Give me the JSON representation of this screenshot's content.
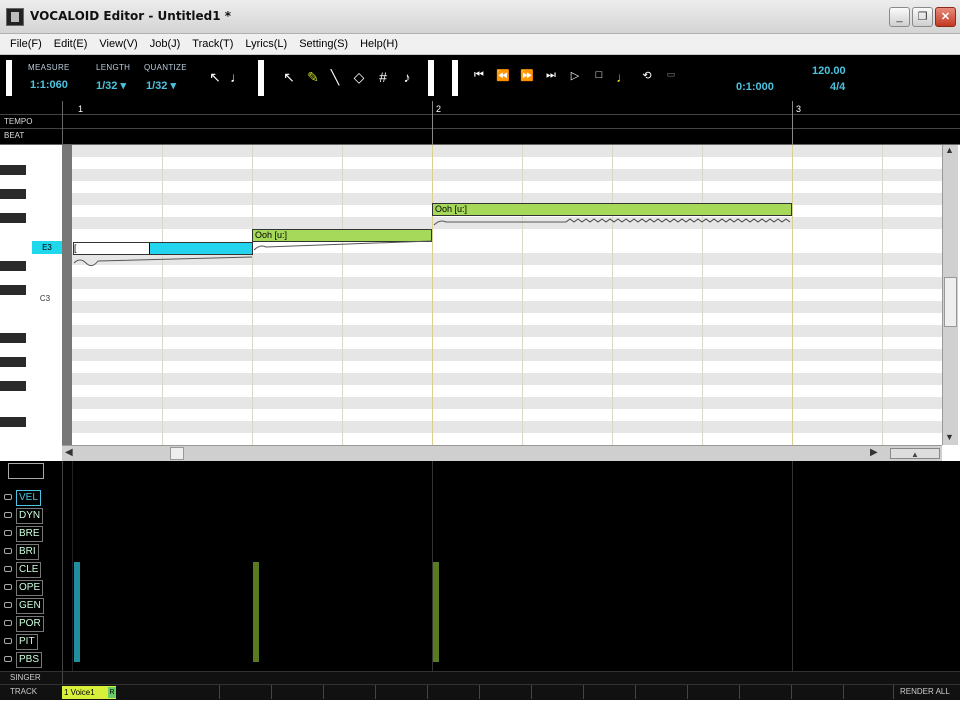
{
  "window": {
    "title": "VOCALOID Editor - Untitled1 *",
    "minimize_icon": "minimize-icon",
    "maximize_icon": "restore-icon",
    "close_icon": "close-icon"
  },
  "menu": [
    "File(F)",
    "Edit(E)",
    "View(V)",
    "Job(J)",
    "Track(T)",
    "Lyrics(L)",
    "Setting(S)",
    "Help(H)"
  ],
  "toolbar": {
    "measure_label": "MEASURE",
    "measure_value": "1:1:060",
    "length_label": "LENGTH",
    "length_value": "1/32",
    "quantize_label": "QUANTIZE",
    "quantize_value": "1/32",
    "position_value": "0:1:000",
    "tempo_value": "120.00",
    "signature_value": "4/4"
  },
  "ruler": {
    "tempo_label": "TEMPO",
    "beat_label": "BEAT",
    "measures": [
      "1",
      "2",
      "3"
    ]
  },
  "piano": {
    "e3_label": "E3",
    "c3_label": "C3"
  },
  "notes": [
    {
      "lyric": "[",
      "color": "#22d4ee"
    },
    {
      "lyric": "Ooh [u:]",
      "color": "#a6d85a"
    },
    {
      "lyric": "Ooh [u:]",
      "color": "#a6d85a"
    }
  ],
  "parameters": [
    "VEL",
    "DYN",
    "BRE",
    "BRI",
    "CLE",
    "OPE",
    "GEN",
    "POR",
    "PIT",
    "PBS"
  ],
  "velocity_bars": [
    {
      "color": "#1f8fa0"
    },
    {
      "color": "#5a7a22"
    },
    {
      "color": "#5a7a22"
    }
  ],
  "bottom": {
    "singer_label": "SINGER",
    "track_label": "TRACK",
    "track_name": "1 Voice1",
    "track_badge": "R",
    "render_all": "RENDER ALL"
  }
}
